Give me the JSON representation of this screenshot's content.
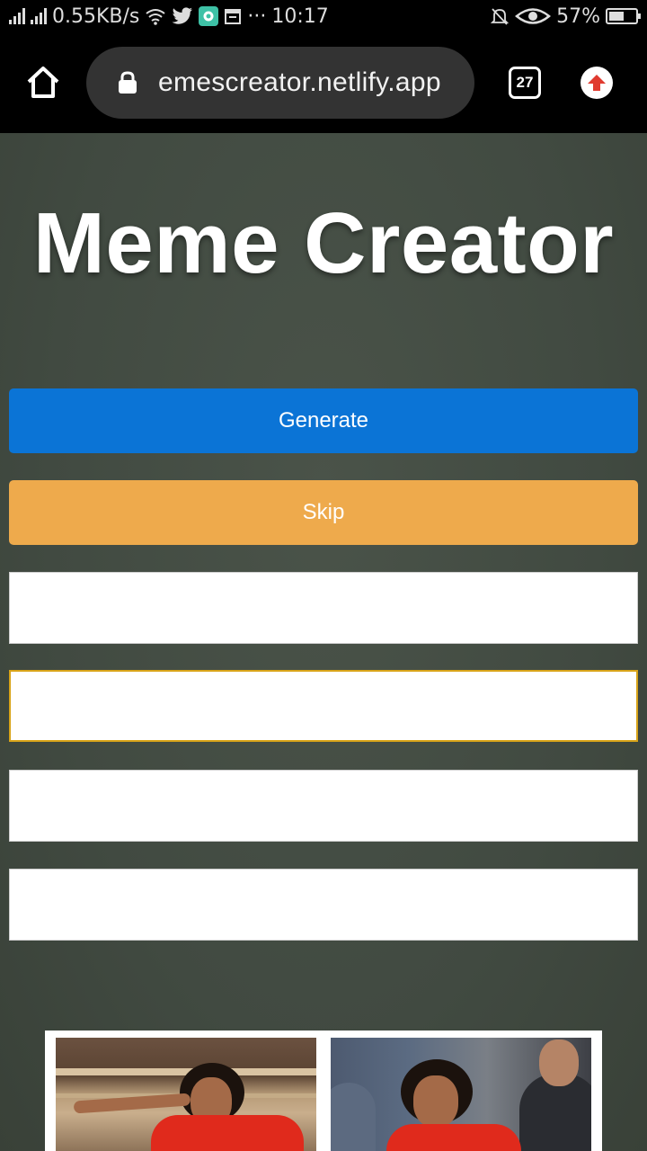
{
  "status_bar": {
    "network_speed": "0.55KB/s",
    "more": "···",
    "time": "10:17",
    "battery": "57%",
    "battery_level": 0.57
  },
  "browser": {
    "url": "emescreator.netlify.app",
    "tab_count": "27"
  },
  "page": {
    "title": "Meme Creator",
    "generate_label": "Generate",
    "skip_label": "Skip",
    "fields": [
      {
        "value": "",
        "placeholder": ""
      },
      {
        "value": "",
        "placeholder": ""
      },
      {
        "value": "",
        "placeholder": ""
      },
      {
        "value": "",
        "placeholder": ""
      }
    ],
    "colors": {
      "generate": "#0b74d6",
      "skip": "#eeaa4c",
      "focus_border": "#d9a419"
    }
  }
}
